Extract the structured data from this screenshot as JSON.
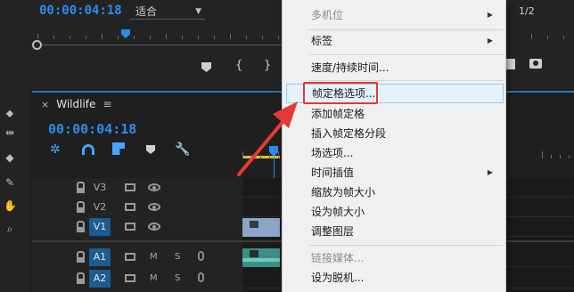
{
  "program_monitor": {
    "timecode": "00:00:04:18",
    "fit_value": "适合",
    "resolution_value": "1/2"
  },
  "timeline": {
    "sequence_name": "Wildlife",
    "timecode": "00:00:04:18",
    "tracks": [
      {
        "name": "V3"
      },
      {
        "name": "V2"
      },
      {
        "name": "V1"
      },
      {
        "name": "A1",
        "m": "M",
        "s": "S"
      },
      {
        "name": "A2",
        "m": "M",
        "s": "S"
      }
    ]
  },
  "context_menu": {
    "items": [
      {
        "label": "多机位",
        "disabled": true,
        "submenu": true
      },
      {
        "label": "标签",
        "submenu": true
      },
      {
        "label": "速度/持续时间..."
      },
      {
        "label": "帧定格选项...",
        "highlighted": true
      },
      {
        "label": "添加帧定格"
      },
      {
        "label": "插入帧定格分段"
      },
      {
        "label": "场选项..."
      },
      {
        "label": "时间插值",
        "submenu": true
      },
      {
        "label": "缩放为帧大小"
      },
      {
        "label": "设为帧大小"
      },
      {
        "label": "调整图层"
      },
      {
        "label": "链接媒体...",
        "disabled": true
      },
      {
        "label": "设为脱机..."
      }
    ],
    "submenu_arrow": "▶"
  },
  "annotation": {
    "color": "#e53935"
  },
  "colors": {
    "accent_blue": "#2d8ceb",
    "menu_bg": "#f0f0f0",
    "hover_bg": "#e5f1fb"
  }
}
